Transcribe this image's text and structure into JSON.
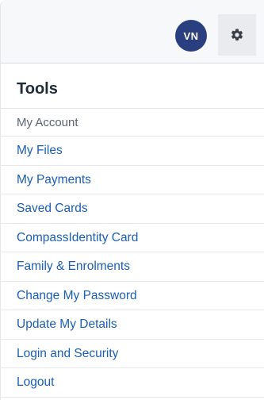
{
  "header": {
    "avatar_initials": "VN",
    "avatar_color": "#2a3f7f",
    "settings_icon": "gear-icon"
  },
  "tools": {
    "title": "Tools",
    "section_label": "My Account",
    "link_color": "#1a5fb4",
    "items": [
      {
        "label": "My Files"
      },
      {
        "label": "My Payments"
      },
      {
        "label": "Saved Cards"
      },
      {
        "label": "CompassIdentity Card"
      },
      {
        "label": "Family & Enrolments"
      },
      {
        "label": "Change My Password"
      },
      {
        "label": "Update My Details"
      },
      {
        "label": "Login and Security"
      },
      {
        "label": "Logout"
      }
    ]
  }
}
